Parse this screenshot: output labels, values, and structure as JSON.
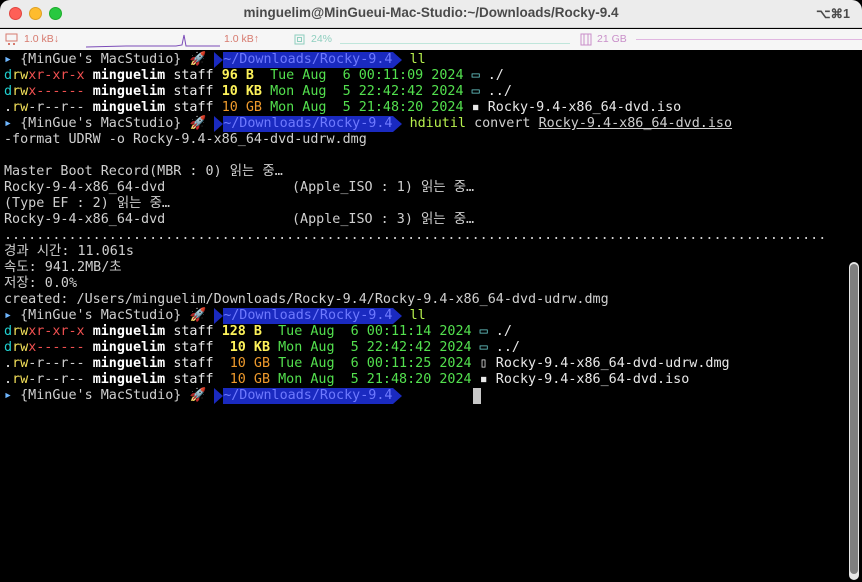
{
  "window": {
    "title": "minguelim@MinGueui-Mac-Studio:~/Downloads/Rocky-9.4",
    "shortcut": "⌥⌘1"
  },
  "statusbar": {
    "net_down": "1.0 kB↓",
    "net_up": "1.0 kB↑",
    "cpu": "24%",
    "mem": "21 GB"
  },
  "prompt": {
    "host": "{MinGue's MacStudio}",
    "rocket": "🚀",
    "path": "~/Downloads/Rocky-9.4"
  },
  "commands": {
    "ll1": "ll",
    "convert_cmd": "hdiutil",
    "convert_arg": "convert",
    "convert_file": "Rocky-9.4-x86_64-dvd.iso",
    "convert_cont": "-format UDRW -o Rocky-9.4-x86_64-dvd-udrw.dmg",
    "ll2": "ll"
  },
  "listing1": [
    {
      "perm": [
        "d",
        "rw",
        "xr-xr-x"
      ],
      "owner": "minguelim",
      "group": "staff",
      "size": "96 B",
      "date": "Tue Aug  6 00:11:09 2024",
      "icon": "📂",
      "name": "./"
    },
    {
      "perm": [
        "d",
        "rw",
        "x------"
      ],
      "owner": "minguelim",
      "group": "staff",
      "size": "10 KB",
      "date": "Mon Aug  5 22:42:42 2024",
      "icon": "📂",
      "name": "../"
    },
    {
      "perm": [
        ".",
        "rw",
        "-r--r--"
      ],
      "owner": "minguelim",
      "group": "staff",
      "size": "10 GB",
      "date": "Mon Aug  5 21:48:20 2024",
      "icon": "🗄",
      "name": "Rocky-9.4-x86_64-dvd.iso"
    }
  ],
  "output": {
    "blank": "",
    "mbr": "Master Boot Record(MBR : 0) 읽는 중…",
    "iso1_name": "Rocky-9-4-x86_64-dvd",
    "iso1_info": "(Apple_ISO : 1) 읽는 중…",
    "typeef": "(Type EF : 2) 읽는 중…",
    "iso3_name": "Rocky-9-4-x86_64-dvd",
    "iso3_info": "(Apple_ISO : 3) 읽는 중…",
    "dots": "......................................................................................................",
    "elapsed": "경과 시간: 11.061s",
    "speed": "속도: 941.2MB/초",
    "saving": "저장: 0.0%",
    "created": "created: /Users/minguelim/Downloads/Rocky-9.4/Rocky-9.4-x86_64-dvd-udrw.dmg"
  },
  "listing2": [
    {
      "perm": [
        "d",
        "rw",
        "xr-xr-x"
      ],
      "owner": "minguelim",
      "group": "staff",
      "size": "128 B",
      "date": "Tue Aug  6 00:11:14 2024",
      "icon": "📂",
      "name": "./"
    },
    {
      "perm": [
        "d",
        "rw",
        "x------"
      ],
      "owner": "minguelim",
      "group": "staff",
      "size": " 10 KB",
      "date": "Mon Aug  5 22:42:42 2024",
      "icon": "📂",
      "name": "../"
    },
    {
      "perm": [
        ".",
        "rw",
        "-r--r--"
      ],
      "owner": "minguelim",
      "group": "staff",
      "size": " 10 GB",
      "date": "Tue Aug  6 00:11:25 2024",
      "icon": "📄",
      "name": "Rocky-9.4-x86_64-dvd-udrw.dmg"
    },
    {
      "perm": [
        ".",
        "rw",
        "-r--r--"
      ],
      "owner": "minguelim",
      "group": "staff",
      "size": " 10 GB",
      "date": "Mon Aug  5 21:48:20 2024",
      "icon": "🗄",
      "name": "Rocky-9.4-x86_64-dvd.iso"
    }
  ]
}
